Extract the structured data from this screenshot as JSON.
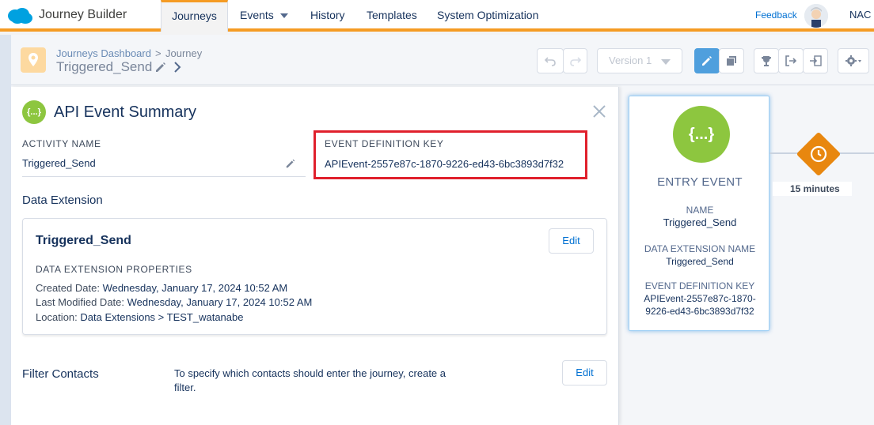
{
  "app": {
    "name": "Journey Builder"
  },
  "nav": {
    "tabs": [
      {
        "label": "Journeys"
      },
      {
        "label": "Events"
      },
      {
        "label": "History"
      },
      {
        "label": "Templates"
      },
      {
        "label": "System Optimization"
      }
    ],
    "feedback": "Feedback",
    "user": "NAC"
  },
  "header": {
    "breadcrumb_link": "Journeys Dashboard",
    "breadcrumb_sep": ">",
    "breadcrumb_current": "Journey",
    "title": "Triggered_Send",
    "version_label": "Version 1"
  },
  "panel": {
    "title": "API Event Summary",
    "icon_text": "{...}",
    "activity_name_label": "ACTIVITY NAME",
    "activity_name_value": "Triggered_Send",
    "event_key_label": "EVENT DEFINITION KEY",
    "event_key_value": "APIEvent-2557e87c-1870-9226-ed43-6bc3893d7f32",
    "data_extension": {
      "heading": "Data Extension",
      "name": "Triggered_Send",
      "edit_label": "Edit",
      "props_label": "DATA EXTENSION PROPERTIES",
      "created_label": "Created Date:",
      "created_value": "Wednesday, January 17, 2024 10:52 AM",
      "modified_label": "Last Modified Date:",
      "modified_value": "Wednesday, January 17, 2024 10:52 AM",
      "location_label": "Location:",
      "location_value": "Data Extensions > TEST_watanabe"
    },
    "filter": {
      "heading": "Filter Contacts",
      "text": "To specify which contacts should enter the journey, create a filter.",
      "edit_label": "Edit"
    }
  },
  "entry_card": {
    "icon_text": "{...}",
    "title": "ENTRY EVENT",
    "name_label": "NAME",
    "name_value": "Triggered_Send",
    "de_label": "DATA EXTENSION NAME",
    "de_value": "Triggered_Send",
    "key_label": "EVENT DEFINITION KEY",
    "key_value": "APIEvent-2557e87c-1870-9226-ed43-6bc3893d7f32"
  },
  "wait": {
    "label": "15 minutes"
  },
  "colors": {
    "accent": "#f59b23",
    "link": "#0070d2",
    "api_green": "#8dc63f",
    "highlight_red": "#e0202c",
    "wait_orange": "#e8870f"
  }
}
